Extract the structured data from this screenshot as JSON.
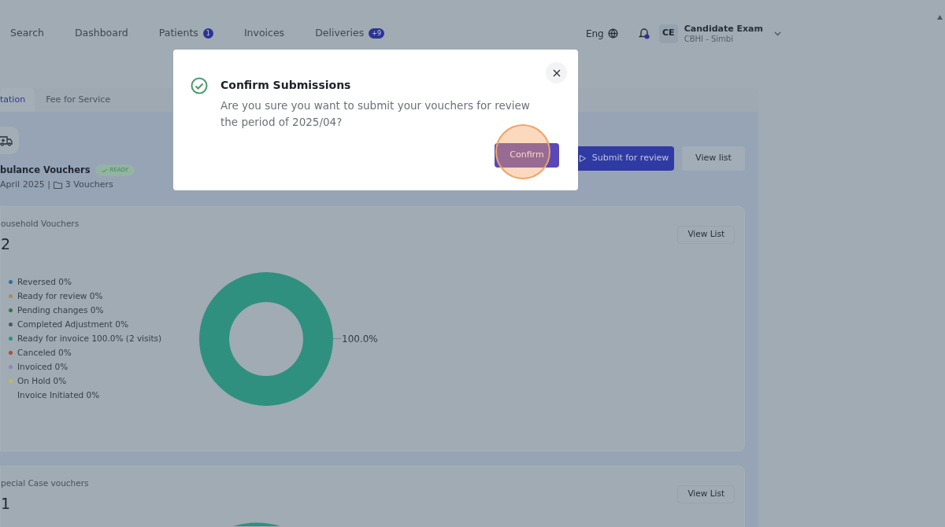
{
  "nav": {
    "items": [
      {
        "label": "Search"
      },
      {
        "label": "Dashboard"
      },
      {
        "label": "Patients",
        "badge": "1"
      },
      {
        "label": "Invoices"
      },
      {
        "label": "Deliveries",
        "badge": "+9"
      }
    ],
    "language": "Eng",
    "user": {
      "initials": "CE",
      "name": "Candidate Exam",
      "org": "CBHI - Simbi"
    }
  },
  "tabs": [
    {
      "label": "tation",
      "selected": true
    },
    {
      "label": "Fee for Service",
      "selected": false
    }
  ],
  "voucher": {
    "title": "bulance Vouchers",
    "status": "READY",
    "period": "April 2025 |",
    "count": "3 Vouchers",
    "actions": [
      {
        "label": "Submit for review",
        "kind": "primary"
      },
      {
        "label": "View list",
        "kind": "secondary"
      }
    ]
  },
  "cards": [
    {
      "title": "ousehold Vouchers",
      "total": "2",
      "button": "View List",
      "legend": [
        {
          "label": "Reversed 0%",
          "color": "#2f6ea8"
        },
        {
          "label": "Ready for review 0%",
          "color": "#a98a5e"
        },
        {
          "label": "Pending changes 0%",
          "color": "#2f7a3e"
        },
        {
          "label": "Completed Adjustment 0%",
          "color": "#4f5862"
        },
        {
          "label": "Ready for invoice 100.0% (2 visits)",
          "color": "#2f9080"
        },
        {
          "label": "Canceled 0%",
          "color": "#b04a3e"
        },
        {
          "label": "Invoiced 0%",
          "color": "#8e86c0"
        },
        {
          "label": "On Hold 0%",
          "color": "#b9bd5a"
        },
        {
          "label": "Invoice Initiated 0%"
        }
      ],
      "donut_label": "100.0%"
    },
    {
      "title": "pecial Case vouchers",
      "total": "1",
      "button": "View List"
    }
  ],
  "dialog": {
    "title": "Confirm Submissions",
    "message": "Are you sure you want to submit your vouchers for review the period of 2025/04?",
    "confirm": "Confirm"
  }
}
